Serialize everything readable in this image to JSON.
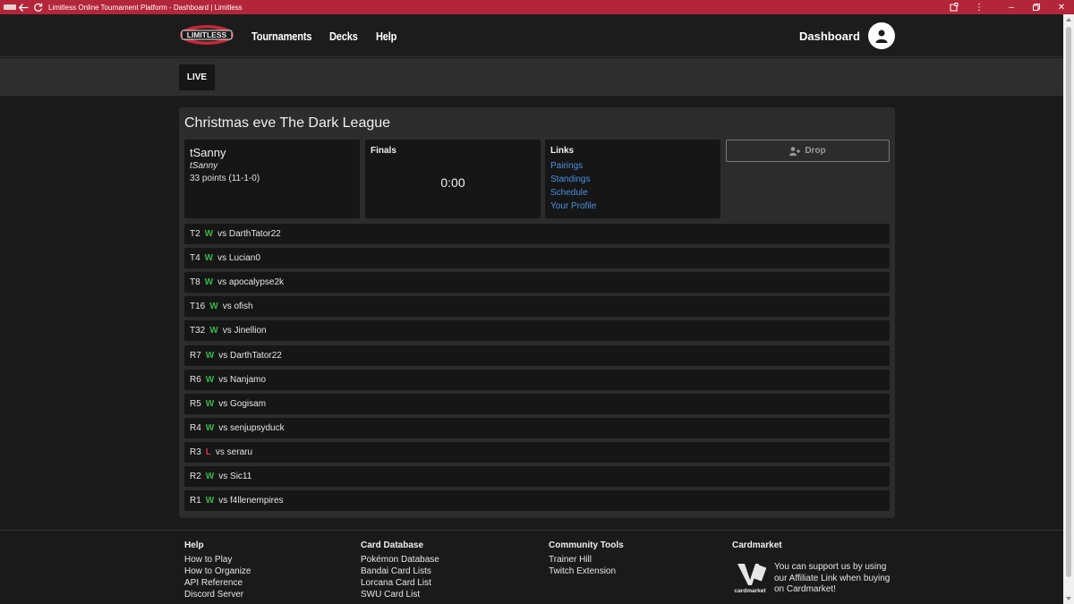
{
  "browser": {
    "title": "Limitless Online Tournament Platform - Dashboard | Limitless",
    "controls": [
      "minimize-icon",
      "restore-icon",
      "close-icon"
    ]
  },
  "header": {
    "logo_text": "LIMITLESS",
    "nav": [
      "Tournaments",
      "Decks",
      "Help"
    ],
    "dashboard_label": "Dashboard"
  },
  "subbar": {
    "tab_label": "LIVE"
  },
  "event": {
    "title": "Christmas eve The Dark League",
    "player": {
      "name": "tSanny",
      "handle": "tSanny",
      "points": "33 points (11-1-0)"
    },
    "phase": {
      "label": "Finals",
      "timer": "0:00"
    },
    "links": {
      "heading": "Links",
      "items": [
        "Pairings",
        "Standings",
        "Schedule",
        "Your Profile"
      ]
    },
    "drop_label": "Drop",
    "matches": [
      {
        "round": "T2",
        "result": "W",
        "opponent": "vs DarthTator22"
      },
      {
        "round": "T4",
        "result": "W",
        "opponent": "vs Lucian0"
      },
      {
        "round": "T8",
        "result": "W",
        "opponent": "vs apocalypse2k"
      },
      {
        "round": "T16",
        "result": "W",
        "opponent": "vs ofish"
      },
      {
        "round": "T32",
        "result": "W",
        "opponent": "vs Jinellion"
      },
      {
        "round": "R7",
        "result": "W",
        "opponent": "vs DarthTator22"
      },
      {
        "round": "R6",
        "result": "W",
        "opponent": "vs Nanjamo"
      },
      {
        "round": "R5",
        "result": "W",
        "opponent": "vs Gogisam"
      },
      {
        "round": "R4",
        "result": "W",
        "opponent": "vs senjupsyduck"
      },
      {
        "round": "R3",
        "result": "L",
        "opponent": "vs seraru"
      },
      {
        "round": "R2",
        "result": "W",
        "opponent": "vs Sic11"
      },
      {
        "round": "R1",
        "result": "W",
        "opponent": "vs f4llenempires"
      }
    ]
  },
  "footer": {
    "help": {
      "heading": "Help",
      "items": [
        "How to Play",
        "How to Organize",
        "API Reference",
        "Discord Server"
      ]
    },
    "card_database": {
      "heading": "Card Database",
      "items": [
        "Pokémon Database",
        "Bandai Card Lists",
        "Lorcana Card List",
        "SWU Card List"
      ]
    },
    "community_tools": {
      "heading": "Community Tools",
      "items": [
        "Trainer Hill",
        "Twitch Extension"
      ]
    },
    "cardmarket": {
      "heading": "Cardmarket",
      "logo_caption": "cardmarket",
      "text": "You can support us by using our Affiliate Link when buying on Cardmarket!"
    }
  },
  "colors": {
    "titlebar": "#b3263a",
    "win": "#3cb54a",
    "loss": "#e0323a",
    "link": "#4a90e2"
  }
}
